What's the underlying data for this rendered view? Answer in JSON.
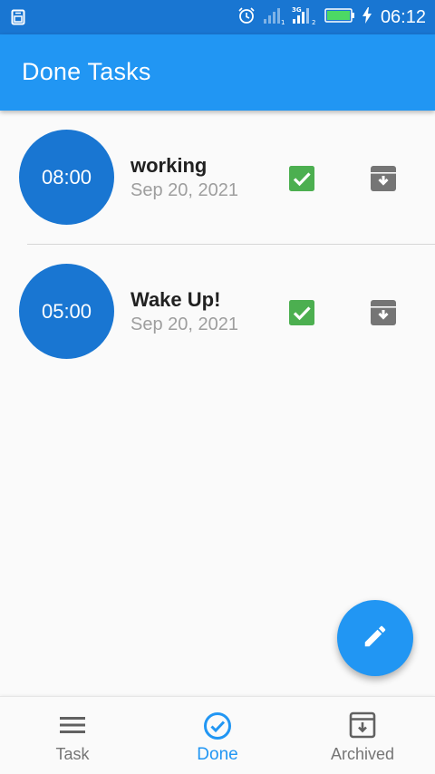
{
  "status_bar": {
    "time": "06:12"
  },
  "app_bar": {
    "title": "Done Tasks"
  },
  "tasks": [
    {
      "time": "08:00",
      "title": "working",
      "date": "Sep 20, 2021",
      "done": true
    },
    {
      "time": "05:00",
      "title": "Wake Up!",
      "date": "Sep 20, 2021",
      "done": true
    }
  ],
  "bottom_nav": {
    "items": [
      {
        "label": "Task",
        "icon": "menu-icon",
        "active": false
      },
      {
        "label": "Done",
        "icon": "check-circle-icon",
        "active": true
      },
      {
        "label": "Archived",
        "icon": "archive-icon",
        "active": false
      }
    ]
  },
  "colors": {
    "primary": "#2196f3",
    "primary_dark": "#1976d2",
    "check_green": "#4caf50",
    "archive_grey": "#757575"
  }
}
